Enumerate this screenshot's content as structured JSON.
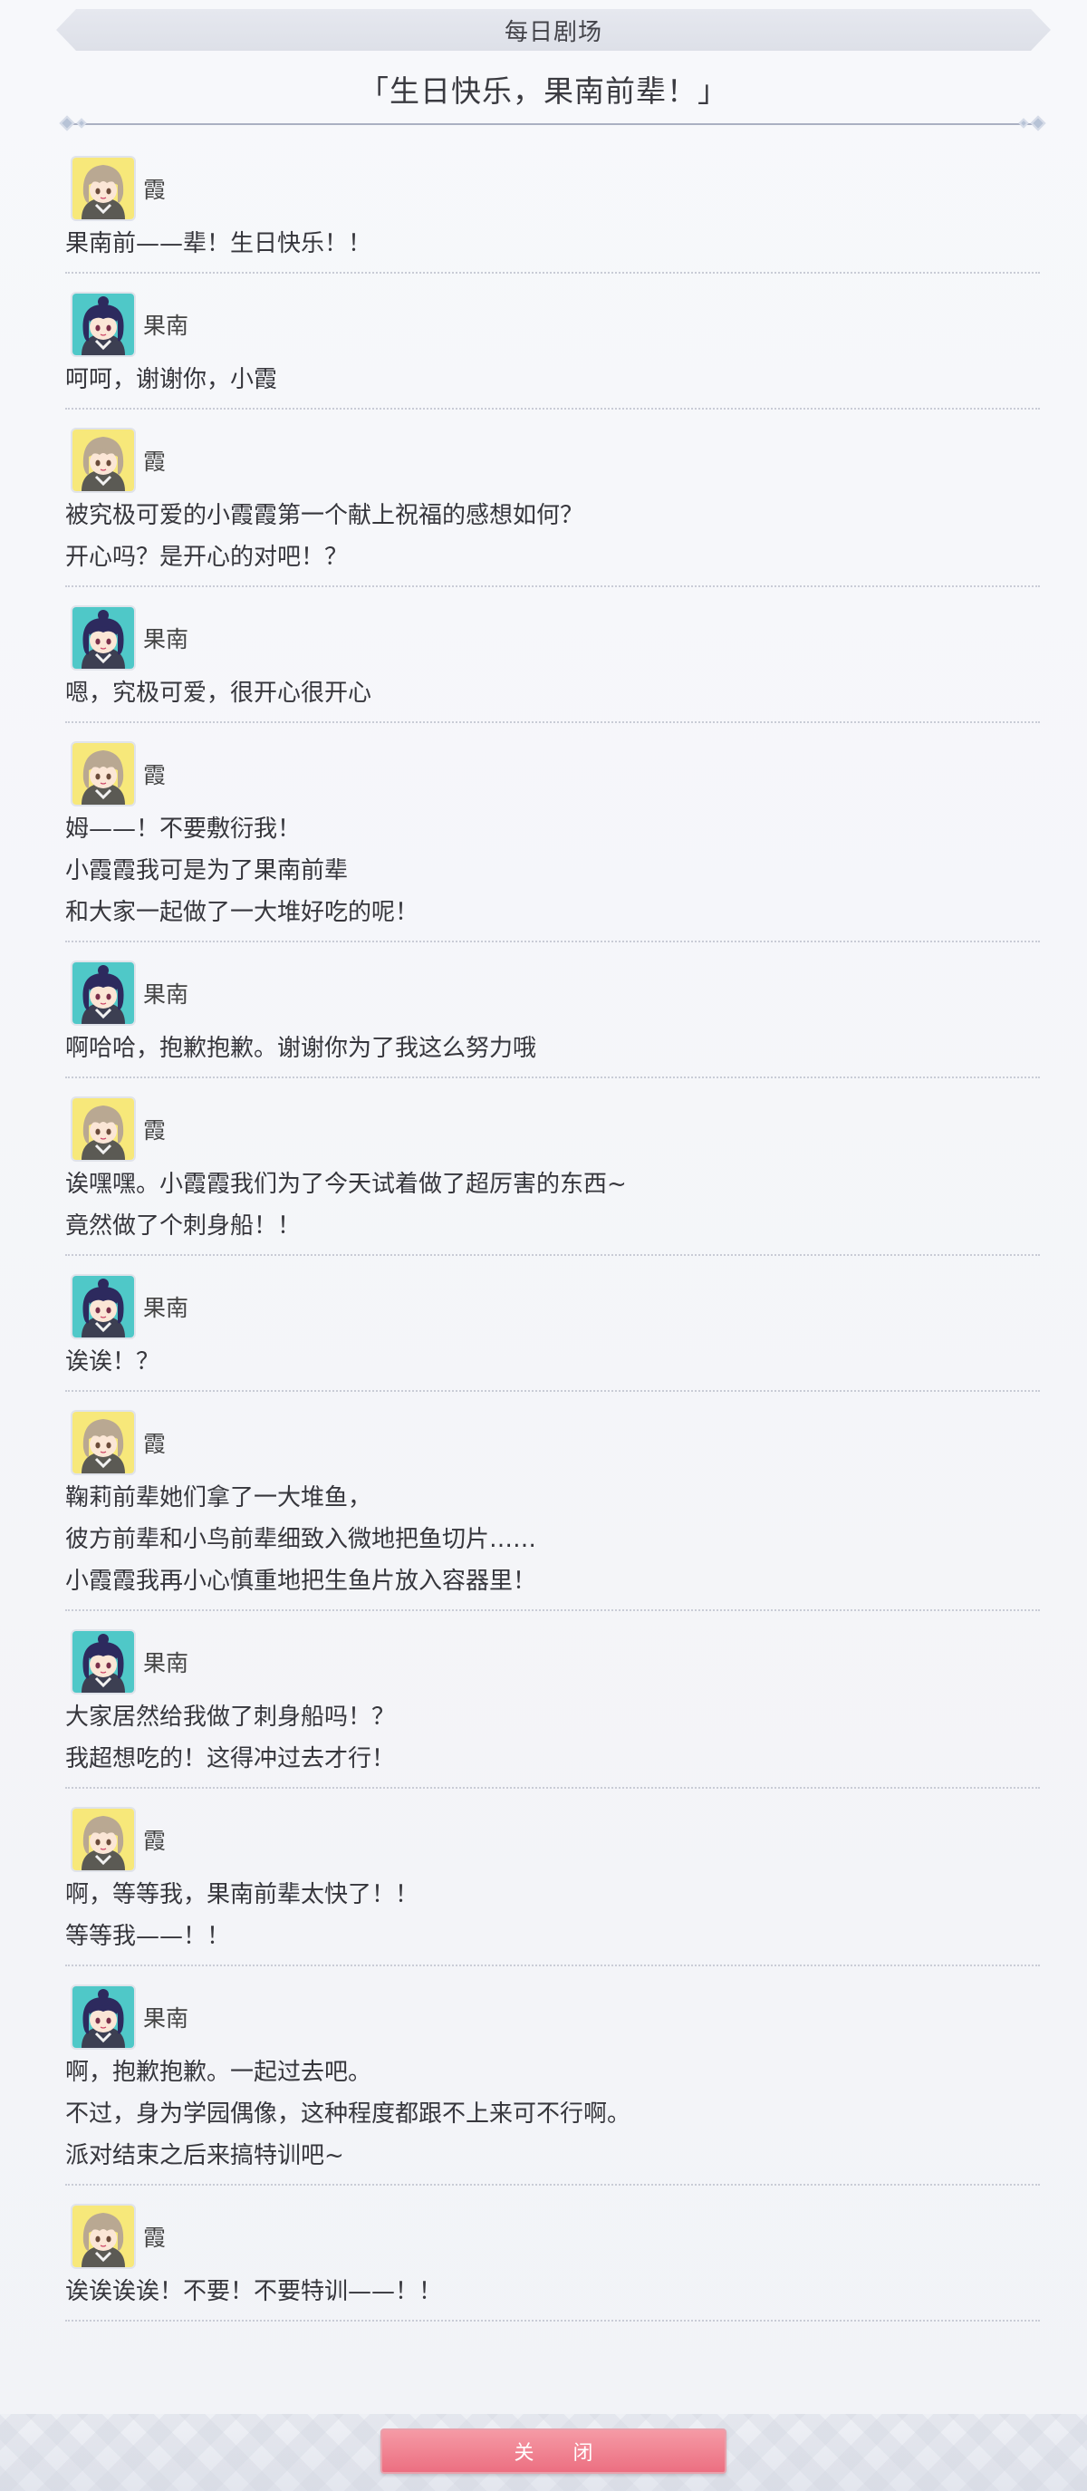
{
  "header": {
    "title": "每日剧场"
  },
  "story": {
    "title": "「生日快乐，果南前辈！」"
  },
  "colors": {
    "accent": "#ec6f81",
    "kasumi_avatar_bg": "#f7e87a",
    "kanan_avatar_bg": "#4fc8c8"
  },
  "entries": [
    {
      "speaker": "霞",
      "avatar": "kasumi-avatar-icon",
      "lines": [
        "果南前——辈！生日快乐！！"
      ]
    },
    {
      "speaker": "果南",
      "avatar": "kanan-avatar-icon",
      "lines": [
        "呵呵，谢谢你，小霞"
      ]
    },
    {
      "speaker": "霞",
      "avatar": "kasumi-avatar-icon",
      "lines": [
        "被究极可爱的小霞霞第一个献上祝福的感想如何？",
        "开心吗？是开心的对吧！？"
      ]
    },
    {
      "speaker": "果南",
      "avatar": "kanan-avatar-icon",
      "lines": [
        "嗯，究极可爱，很开心很开心"
      ]
    },
    {
      "speaker": "霞",
      "avatar": "kasumi-avatar-icon",
      "lines": [
        "姆——！不要敷衍我！",
        "小霞霞我可是为了果南前辈",
        "和大家一起做了一大堆好吃的呢！"
      ]
    },
    {
      "speaker": "果南",
      "avatar": "kanan-avatar-icon",
      "lines": [
        "啊哈哈，抱歉抱歉。谢谢你为了我这么努力哦"
      ]
    },
    {
      "speaker": "霞",
      "avatar": "kasumi-avatar-icon",
      "lines": [
        "诶嘿嘿。小霞霞我们为了今天试着做了超厉害的东西~",
        "竟然做了个刺身船！！"
      ]
    },
    {
      "speaker": "果南",
      "avatar": "kanan-avatar-icon",
      "lines": [
        "诶诶！？"
      ]
    },
    {
      "speaker": "霞",
      "avatar": "kasumi-avatar-icon",
      "lines": [
        "鞠莉前辈她们拿了一大堆鱼，",
        "彼方前辈和小鸟前辈细致入微地把鱼切片……",
        "小霞霞我再小心慎重地把生鱼片放入容器里！"
      ]
    },
    {
      "speaker": "果南",
      "avatar": "kanan-avatar-icon",
      "lines": [
        "大家居然给我做了刺身船吗！？",
        "我超想吃的！这得冲过去才行！"
      ]
    },
    {
      "speaker": "霞",
      "avatar": "kasumi-avatar-icon",
      "lines": [
        "啊，等等我，果南前辈太快了！！",
        "等等我——！！"
      ]
    },
    {
      "speaker": "果南",
      "avatar": "kanan-avatar-icon",
      "lines": [
        "啊，抱歉抱歉。一起过去吧。",
        "不过，身为学园偶像，这种程度都跟不上来可不行啊。",
        "派对结束之后来搞特训吧~"
      ]
    },
    {
      "speaker": "霞",
      "avatar": "kasumi-avatar-icon",
      "lines": [
        "诶诶诶诶！不要！不要特训——！！"
      ]
    }
  ],
  "footer": {
    "close_label": "关 闭"
  }
}
